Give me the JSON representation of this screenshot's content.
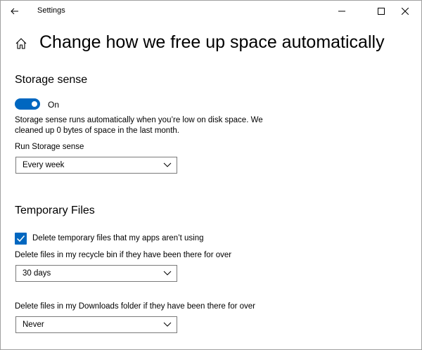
{
  "window": {
    "title": "Settings"
  },
  "header": {
    "title": "Change how we free up space automatically"
  },
  "storage_sense": {
    "section_title": "Storage sense",
    "toggle_state": "On",
    "toggle_on": true,
    "description_line1": "Storage sense runs automatically when you’re low on disk space. We",
    "description_line2": "cleaned up 0 bytes of space in the last month.",
    "run_label": "Run Storage sense",
    "run_value": "Every week"
  },
  "temporary_files": {
    "section_title": "Temporary Files",
    "delete_temp_label": "Delete temporary files that my apps aren’t using",
    "delete_temp_checked": true,
    "recycle_label": "Delete files in my recycle bin if they have been there for over",
    "recycle_value": "30 days",
    "downloads_label": "Delete files in my Downloads folder if they have been there for over",
    "downloads_value": "Never"
  },
  "colors": {
    "accent": "#0067c0",
    "border": "#7a7a7a",
    "text": "#000000"
  },
  "icons": {
    "back": "arrow-left-icon",
    "home": "home-icon",
    "minimize": "minimize-icon",
    "maximize": "maximize-icon",
    "close": "close-icon",
    "chevron": "chevron-down-icon",
    "check": "checkmark-icon"
  }
}
